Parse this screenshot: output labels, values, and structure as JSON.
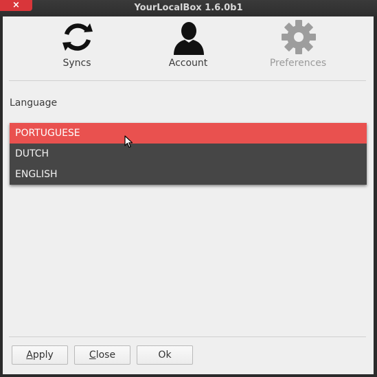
{
  "window": {
    "title": "YourLocalBox 1.6.0b1",
    "close_glyph": "×"
  },
  "toolbar": {
    "tabs": [
      {
        "label": "Syncs",
        "icon": "sync-icon",
        "enabled": true
      },
      {
        "label": "Account",
        "icon": "user-icon",
        "enabled": true
      },
      {
        "label": "Preferences",
        "icon": "gear-icon",
        "enabled": false
      }
    ]
  },
  "preferences": {
    "language_label": "Language",
    "language_options": [
      {
        "label": "PORTUGUESE",
        "highlighted": true
      },
      {
        "label": "DUTCH",
        "highlighted": false
      },
      {
        "label": "ENGLISH",
        "highlighted": false
      }
    ]
  },
  "buttons": {
    "apply": {
      "mnemonic": "A",
      "rest": "pply"
    },
    "close": {
      "mnemonic": "C",
      "rest": "lose"
    },
    "ok": {
      "label": "Ok"
    }
  },
  "colors": {
    "titlebar": "#2e2e2e",
    "close_button": "#d9363a",
    "highlight": "#e9514f",
    "dropdown_bg": "#464646",
    "panel_bg": "#efefef"
  }
}
